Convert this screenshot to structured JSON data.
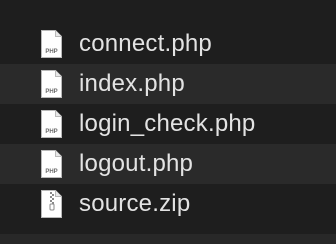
{
  "files": [
    {
      "name": "connect.php",
      "icon": "php-file-icon",
      "icon_label": "PHP"
    },
    {
      "name": "index.php",
      "icon": "php-file-icon",
      "icon_label": "PHP"
    },
    {
      "name": "login_check.php",
      "icon": "php-file-icon",
      "icon_label": "PHP"
    },
    {
      "name": "logout.php",
      "icon": "php-file-icon",
      "icon_label": "PHP"
    },
    {
      "name": "source.zip",
      "icon": "zip-archive-icon"
    }
  ],
  "colors": {
    "background": "#1e1e1e",
    "alt_row": "#2a2a2a",
    "text": "#e3e3e3"
  }
}
